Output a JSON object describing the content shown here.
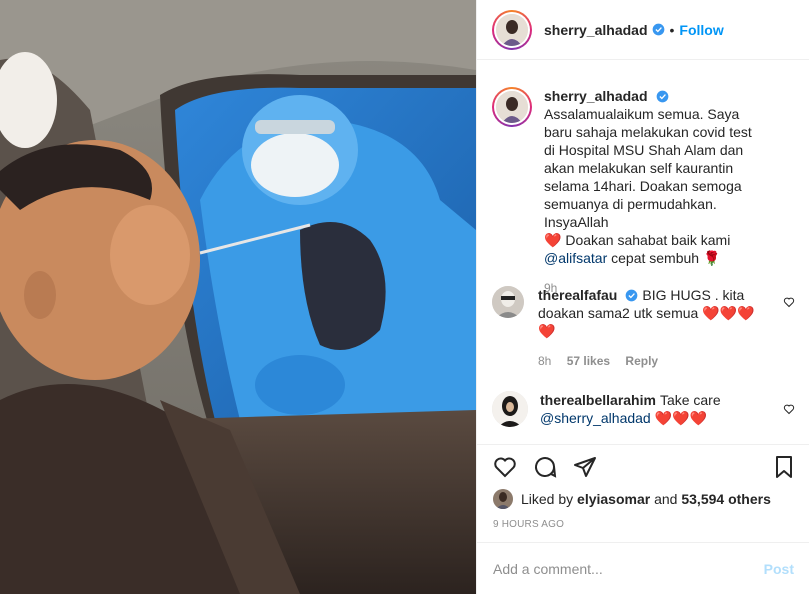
{
  "post": {
    "username": "sherry_alhadad",
    "follow_label": "Follow",
    "dot": "•"
  },
  "caption": {
    "username": "sherry_alhadad",
    "text": "Assalamualaikum semua. Saya baru sahaja melakukan covid test di Hospital MSU Shah Alam dan akan melakukan self kaurantin selama 14hari. Doakan semoga semuanya di permudahkan. InsyaAllah",
    "text2": "Doakan sahabat baik kami",
    "mention": "@alifsatar",
    "text3": "cepat sembuh",
    "time": "9h"
  },
  "comments": [
    {
      "username": "therealfafau",
      "text": "BIG HUGS . kita doakan sama2 utk semua",
      "time": "8h",
      "likes": "57 likes",
      "reply": "Reply"
    },
    {
      "username": "therealbellarahim",
      "text": "Take care",
      "mention": "@sherry_alhadad"
    }
  ],
  "likes": {
    "prefix": "Liked by",
    "user": "elyiasomar",
    "and": "and",
    "count": "53,594 others"
  },
  "timestamp": "9 HOURS AGO",
  "add_comment": {
    "placeholder": "Add a comment...",
    "post_label": "Post"
  },
  "colors": {
    "link_blue": "#0095f6",
    "mention": "#00376b",
    "heart_red": "#ed4956",
    "muted": "#8e8e8e"
  }
}
